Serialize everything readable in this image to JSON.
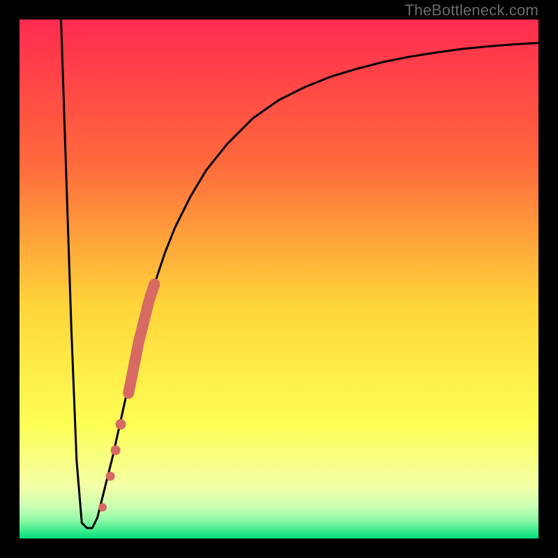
{
  "watermark": "TheBottleneck.com",
  "colors": {
    "frame": "#000000",
    "curve": "#000000",
    "marker_fill": "#d76a62",
    "marker_stroke": "#b84e46",
    "gradient_top": "#ff2b4f",
    "gradient_upper_mid": "#ff7a3a",
    "gradient_mid": "#ffd53a",
    "gradient_lower_mid": "#f6ff6a",
    "gradient_green_band_top": "#d8ffb0",
    "gradient_green_band_mid": "#7cf59a",
    "gradient_bottom": "#00e07d"
  },
  "chart_data": {
    "type": "line",
    "title": "",
    "xlabel": "",
    "ylabel": "",
    "xlim": [
      0,
      100
    ],
    "ylim": [
      0,
      100
    ],
    "grid": false,
    "series": [
      {
        "name": "bottleneck-curve",
        "x": [
          8,
          9,
          10,
          11,
          12,
          13,
          14,
          15,
          16,
          18,
          20,
          22,
          24,
          26,
          28,
          30,
          33,
          36,
          40,
          45,
          50,
          55,
          60,
          65,
          70,
          75,
          80,
          85,
          90,
          95,
          100
        ],
        "y": [
          100,
          70,
          40,
          15,
          3,
          2,
          2,
          4,
          8,
          16,
          25,
          34,
          42,
          49,
          55,
          60,
          66,
          71,
          76,
          81,
          84.5,
          87,
          89,
          90.5,
          91.8,
          92.8,
          93.6,
          94.3,
          94.8,
          95.2,
          95.5
        ]
      }
    ],
    "markers": {
      "name": "highlighted-points",
      "points": [
        {
          "x": 16.0,
          "y": 6
        },
        {
          "x": 17.5,
          "y": 12
        },
        {
          "x": 18.5,
          "y": 17
        },
        {
          "x": 19.5,
          "y": 22
        },
        {
          "x": 21.0,
          "y": 28
        },
        {
          "x": 22.0,
          "y": 33
        },
        {
          "x": 23.0,
          "y": 38
        },
        {
          "x": 24.0,
          "y": 42
        },
        {
          "x": 25.0,
          "y": 46
        },
        {
          "x": 26.0,
          "y": 49
        }
      ]
    }
  }
}
